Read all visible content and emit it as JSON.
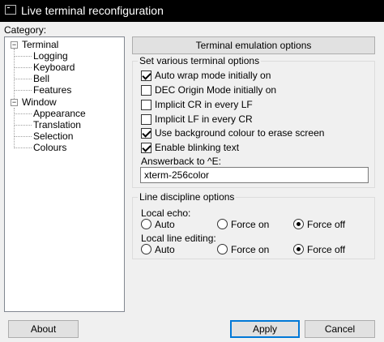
{
  "window": {
    "title": "Live terminal reconfiguration",
    "icon": "terminal-icon"
  },
  "category_label": "Category:",
  "tree": {
    "terminal": "Terminal",
    "logging": "Logging",
    "keyboard": "Keyboard",
    "bell": "Bell",
    "features": "Features",
    "window": "Window",
    "appearance": "Appearance",
    "translation": "Translation",
    "selection": "Selection",
    "colours": "Colours",
    "collapse_glyph": "−"
  },
  "panel": {
    "header_button": "Terminal emulation options",
    "options_group": {
      "legend": "Set various terminal options",
      "checkboxes": [
        {
          "label": "Auto wrap mode initially on",
          "checked": true
        },
        {
          "label": "DEC Origin Mode initially on",
          "checked": false
        },
        {
          "label": "Implicit CR in every LF",
          "checked": false
        },
        {
          "label": "Implicit LF in every CR",
          "checked": false
        },
        {
          "label": "Use background colour to erase screen",
          "checked": true
        },
        {
          "label": "Enable blinking text",
          "checked": true
        }
      ],
      "answerback_label": "Answerback to ^E:",
      "answerback_value": "xterm-256color"
    },
    "line_group": {
      "legend": "Line discipline options",
      "local_echo": {
        "label": "Local echo:",
        "options": [
          "Auto",
          "Force on",
          "Force off"
        ],
        "selected": "Force off"
      },
      "local_line_editing": {
        "label": "Local line editing:",
        "options": [
          "Auto",
          "Force on",
          "Force off"
        ],
        "selected": "Force off"
      }
    }
  },
  "buttons": {
    "about": "About",
    "apply": "Apply",
    "cancel": "Cancel"
  },
  "colors": {
    "titlebar": "#000000",
    "accent": "#0078d7",
    "dialog_bg": "#f0f0f0"
  }
}
